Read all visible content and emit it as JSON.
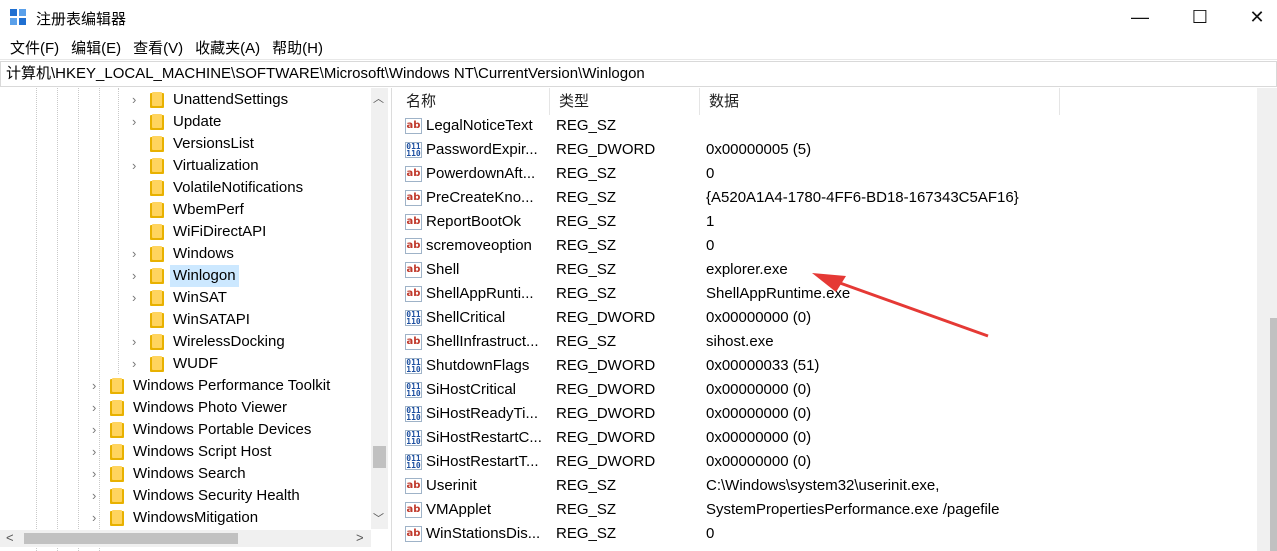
{
  "window": {
    "title": "注册表编辑器",
    "minimize": "—",
    "maximize": "☐",
    "close": "✕"
  },
  "menu": [
    "文件(F)",
    "编辑(E)",
    "查看(V)",
    "收藏夹(A)",
    "帮助(H)"
  ],
  "address": "计算机\\HKEY_LOCAL_MACHINE\\SOFTWARE\\Microsoft\\Windows NT\\CurrentVersion\\Winlogon",
  "tree": [
    {
      "label": "UnattendSettings",
      "expandable": true,
      "selected": false
    },
    {
      "label": "Update",
      "expandable": true,
      "selected": false
    },
    {
      "label": "VersionsList",
      "expandable": false,
      "selected": false
    },
    {
      "label": "Virtualization",
      "expandable": true,
      "selected": false
    },
    {
      "label": "VolatileNotifications",
      "expandable": false,
      "selected": false
    },
    {
      "label": "WbemPerf",
      "expandable": false,
      "selected": false
    },
    {
      "label": "WiFiDirectAPI",
      "expandable": false,
      "selected": false
    },
    {
      "label": "Windows",
      "expandable": true,
      "selected": false
    },
    {
      "label": "Winlogon",
      "expandable": true,
      "selected": true
    },
    {
      "label": "WinSAT",
      "expandable": true,
      "selected": false
    },
    {
      "label": "WinSATAPI",
      "expandable": false,
      "selected": false
    },
    {
      "label": "WirelessDocking",
      "expandable": true,
      "selected": false
    },
    {
      "label": "WUDF",
      "expandable": true,
      "selected": false
    },
    {
      "label": "Windows Performance Toolkit",
      "expandable": true,
      "selected": false
    },
    {
      "label": "Windows Photo Viewer",
      "expandable": true,
      "selected": false
    },
    {
      "label": "Windows Portable Devices",
      "expandable": true,
      "selected": false
    },
    {
      "label": "Windows Script Host",
      "expandable": true,
      "selected": false
    },
    {
      "label": "Windows Search",
      "expandable": true,
      "selected": false
    },
    {
      "label": "Windows Security Health",
      "expandable": true,
      "selected": false
    },
    {
      "label": "WindowsMitigation",
      "expandable": true,
      "selected": false
    }
  ],
  "columns": {
    "name": "名称",
    "type": "类型",
    "data": "数据"
  },
  "values": [
    {
      "icon": "string-value-icon",
      "name": "LegalNoticeText",
      "type": "REG_SZ",
      "data": ""
    },
    {
      "icon": "binary-value-icon",
      "name": "PasswordExpir...",
      "type": "REG_DWORD",
      "data": "0x00000005 (5)"
    },
    {
      "icon": "string-value-icon",
      "name": "PowerdownAft...",
      "type": "REG_SZ",
      "data": "0"
    },
    {
      "icon": "string-value-icon",
      "name": "PreCreateKno...",
      "type": "REG_SZ",
      "data": "{A520A1A4-1780-4FF6-BD18-167343C5AF16}"
    },
    {
      "icon": "string-value-icon",
      "name": "ReportBootOk",
      "type": "REG_SZ",
      "data": "1"
    },
    {
      "icon": "string-value-icon",
      "name": "scremoveoption",
      "type": "REG_SZ",
      "data": "0"
    },
    {
      "icon": "string-value-icon",
      "name": "Shell",
      "type": "REG_SZ",
      "data": "explorer.exe"
    },
    {
      "icon": "string-value-icon",
      "name": "ShellAppRunti...",
      "type": "REG_SZ",
      "data": "ShellAppRuntime.exe"
    },
    {
      "icon": "binary-value-icon",
      "name": "ShellCritical",
      "type": "REG_DWORD",
      "data": "0x00000000 (0)"
    },
    {
      "icon": "string-value-icon",
      "name": "ShellInfrastruct...",
      "type": "REG_SZ",
      "data": "sihost.exe"
    },
    {
      "icon": "binary-value-icon",
      "name": "ShutdownFlags",
      "type": "REG_DWORD",
      "data": "0x00000033 (51)"
    },
    {
      "icon": "binary-value-icon",
      "name": "SiHostCritical",
      "type": "REG_DWORD",
      "data": "0x00000000 (0)"
    },
    {
      "icon": "binary-value-icon",
      "name": "SiHostReadyTi...",
      "type": "REG_DWORD",
      "data": "0x00000000 (0)"
    },
    {
      "icon": "binary-value-icon",
      "name": "SiHostRestartC...",
      "type": "REG_DWORD",
      "data": "0x00000000 (0)"
    },
    {
      "icon": "binary-value-icon",
      "name": "SiHostRestartT...",
      "type": "REG_DWORD",
      "data": "0x00000000 (0)"
    },
    {
      "icon": "string-value-icon",
      "name": "Userinit",
      "type": "REG_SZ",
      "data": "C:\\Windows\\system32\\userinit.exe,"
    },
    {
      "icon": "string-value-icon",
      "name": "VMApplet",
      "type": "REG_SZ",
      "data": "SystemPropertiesPerformance.exe /pagefile"
    },
    {
      "icon": "string-value-icon",
      "name": "WinStationsDis...",
      "type": "REG_SZ",
      "data": "0"
    }
  ],
  "glyphs": {
    "string_icon": "ab",
    "binary_icon": "011\n110",
    "chevron_right": "›",
    "scroll_up": "︿",
    "scroll_down": "﹀",
    "scroll_left": "<",
    "scroll_right": ">"
  },
  "colors": {
    "selection": "#cce8ff",
    "annotation_arrow": "#e53935",
    "app_icon": "#1f6fd1"
  }
}
